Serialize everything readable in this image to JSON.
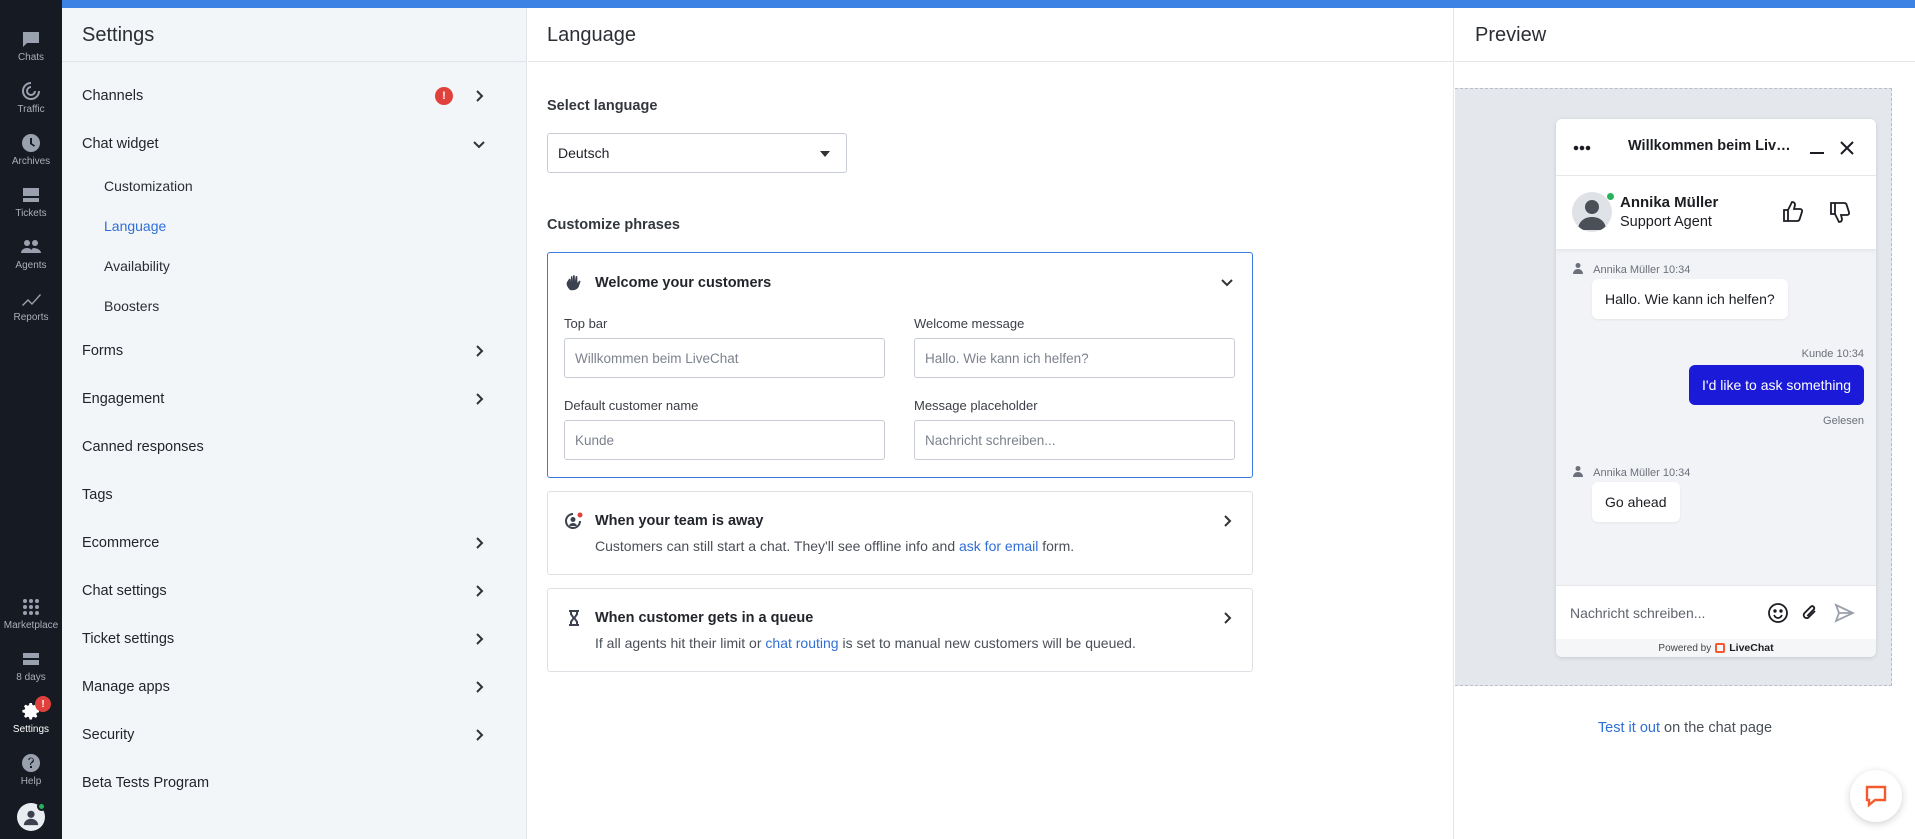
{
  "rail": {
    "items": [
      {
        "label": "Chats",
        "icon": "chat-bubble-icon"
      },
      {
        "label": "Traffic",
        "icon": "radar-icon"
      },
      {
        "label": "Archives",
        "icon": "clock-icon"
      },
      {
        "label": "Tickets",
        "icon": "ticket-icon"
      },
      {
        "label": "Agents",
        "icon": "people-icon"
      },
      {
        "label": "Reports",
        "icon": "trend-line-icon"
      },
      {
        "label": "Marketplace",
        "icon": "grid-icon"
      },
      {
        "label": "8 days",
        "icon": "trial-icon"
      },
      {
        "label": "Settings",
        "icon": "gear-icon",
        "badge": "!"
      },
      {
        "label": "Help",
        "icon": "help-icon"
      }
    ]
  },
  "settings": {
    "title": "Settings",
    "items": [
      {
        "label": "Channels",
        "badge": "!"
      },
      {
        "label": "Chat widget"
      },
      {
        "label": "Customization"
      },
      {
        "label": "Language"
      },
      {
        "label": "Availability"
      },
      {
        "label": "Boosters"
      },
      {
        "label": "Forms"
      },
      {
        "label": "Engagement"
      },
      {
        "label": "Canned responses"
      },
      {
        "label": "Tags"
      },
      {
        "label": "Ecommerce"
      },
      {
        "label": "Chat settings"
      },
      {
        "label": "Ticket settings"
      },
      {
        "label": "Manage apps"
      },
      {
        "label": "Security"
      },
      {
        "label": "Beta Tests Program"
      }
    ]
  },
  "language": {
    "title": "Language",
    "select_label": "Select language",
    "selected": "Deutsch",
    "customize_label": "Customize phrases",
    "welcome": {
      "title": "Welcome your customers",
      "top_bar_label": "Top bar",
      "top_bar_placeholder": "Willkommen beim LiveChat",
      "welcome_msg_label": "Welcome message",
      "welcome_msg_placeholder": "Hallo. Wie kann ich helfen?",
      "customer_name_label": "Default customer name",
      "customer_name_placeholder": "Kunde",
      "msg_placeholder_label": "Message placeholder",
      "msg_placeholder_placeholder": "Nachricht schreiben..."
    },
    "away": {
      "title": "When your team is away",
      "desc_pre": "Customers can still start a chat. They'll see offline info and ",
      "desc_link": "ask for email",
      "desc_post": " form."
    },
    "queue": {
      "title": "When customer gets in a queue",
      "desc_pre": "If all agents hit their limit or ",
      "desc_link": "chat routing",
      "desc_post": " is set to manual new customers will be queued."
    }
  },
  "preview": {
    "title": "Preview",
    "widget": {
      "title": "Willkommen beim LiveChat",
      "agent_name": "Annika Müller",
      "agent_role": "Support Agent",
      "messages": [
        {
          "meta": "Annika Müller 10:34",
          "text": "Hallo. Wie kann ich helfen?"
        },
        {
          "meta": "Kunde 10:34",
          "text": "I'd like to ask something",
          "status": "Gelesen"
        },
        {
          "meta": "Annika Müller 10:34",
          "text": "Go ahead"
        }
      ],
      "input_placeholder": "Nachricht schreiben...",
      "powered_by": "Powered by",
      "brand": "LiveChat"
    },
    "test_link": "Test it out",
    "test_rest": " on the chat page"
  },
  "colors": {
    "accent": "#3b82e4",
    "link": "#2f6fd6",
    "badge": "#e0413c",
    "customer_bubble": "#1a1ad8",
    "brand": "#f35a2e"
  }
}
